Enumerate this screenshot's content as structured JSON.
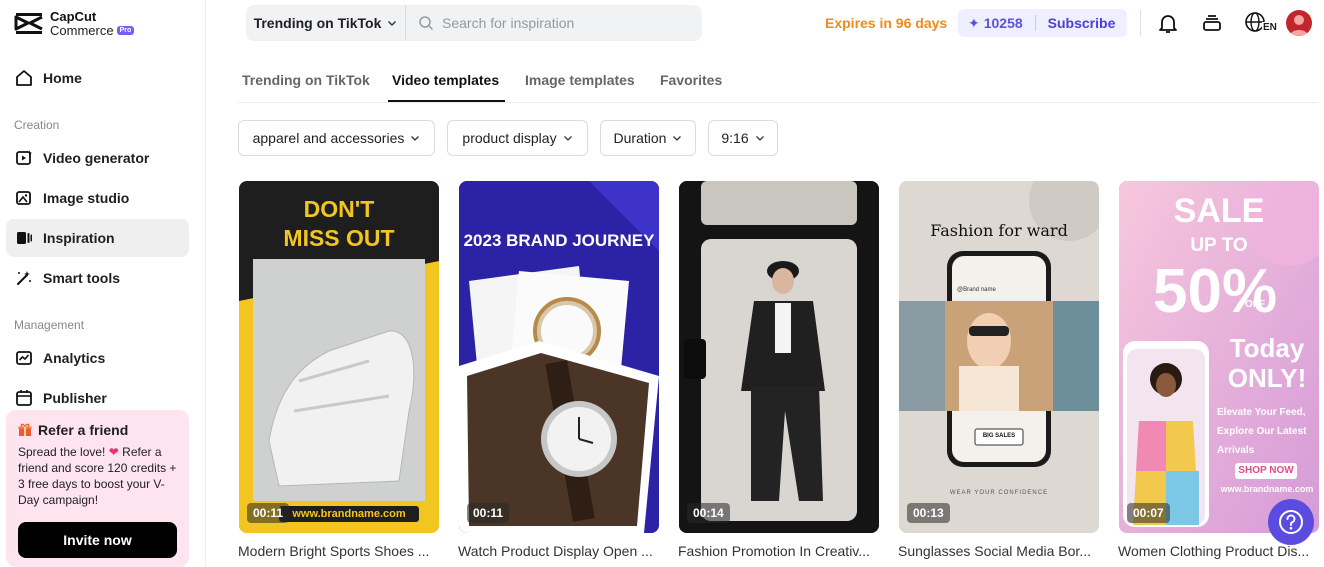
{
  "brand": {
    "line1": "CapCut",
    "line2": "Commerce",
    "badge": "Pro"
  },
  "nav": {
    "home": "Home",
    "section_creation": "Creation",
    "video_generator": "Video generator",
    "image_studio": "Image studio",
    "inspiration": "Inspiration",
    "smart_tools": "Smart tools",
    "section_management": "Management",
    "analytics": "Analytics",
    "publisher": "Publisher"
  },
  "refer": {
    "title": "Refer a friend",
    "text1": "Spread the love!",
    "text2": "Refer a friend and score 120 credits + 3 free days to boost your V-Day campaign!",
    "button": "Invite now"
  },
  "topbar": {
    "search_scope": "Trending on TikTok",
    "search_placeholder": "Search for inspiration",
    "expires": "Expires in 96 days",
    "credits": "10258",
    "subscribe": "Subscribe",
    "lang": "EN"
  },
  "tabs": [
    "Trending on TikTok",
    "Video templates",
    "Image templates",
    "Favorites"
  ],
  "active_tab": "Video templates",
  "filters": [
    "apparel and accessories",
    "product display",
    "Duration",
    "9:16"
  ],
  "cards": [
    {
      "duration": "00:11",
      "caption": "Modern Bright Sports Shoes ...",
      "headline1": "DON'T",
      "headline2": "MISS OUT",
      "footer": "www.brandname.com"
    },
    {
      "duration": "00:11",
      "caption": "Watch Product Display Open ...",
      "headline1": "2023 BRAND JOURNEY"
    },
    {
      "duration": "00:14",
      "caption": "Fashion Promotion In Creativ..."
    },
    {
      "duration": "00:13",
      "caption": "Sunglasses Social Media Bor...",
      "headline1": "Fashion for ward",
      "handle": "@Brand name",
      "badge": "BIG SALES",
      "footer": "WEAR YOUR CONFIDENCE"
    },
    {
      "duration": "00:07",
      "caption": "Women Clothing Product Dis...",
      "headline1": "SALE",
      "headline2": "UP TO",
      "headline3": "50%",
      "off": "OFF",
      "headline4": "Today",
      "headline5": "ONLY!",
      "text": "Elevate Your Feed, Explore Our Latest Arrivals",
      "cta": "SHOP NOW",
      "footer": "www.brandname.com"
    }
  ],
  "colors": {
    "accent": "#5b4ce0",
    "expires": "#f08a1a",
    "refer_bg": "#fde4ee"
  }
}
